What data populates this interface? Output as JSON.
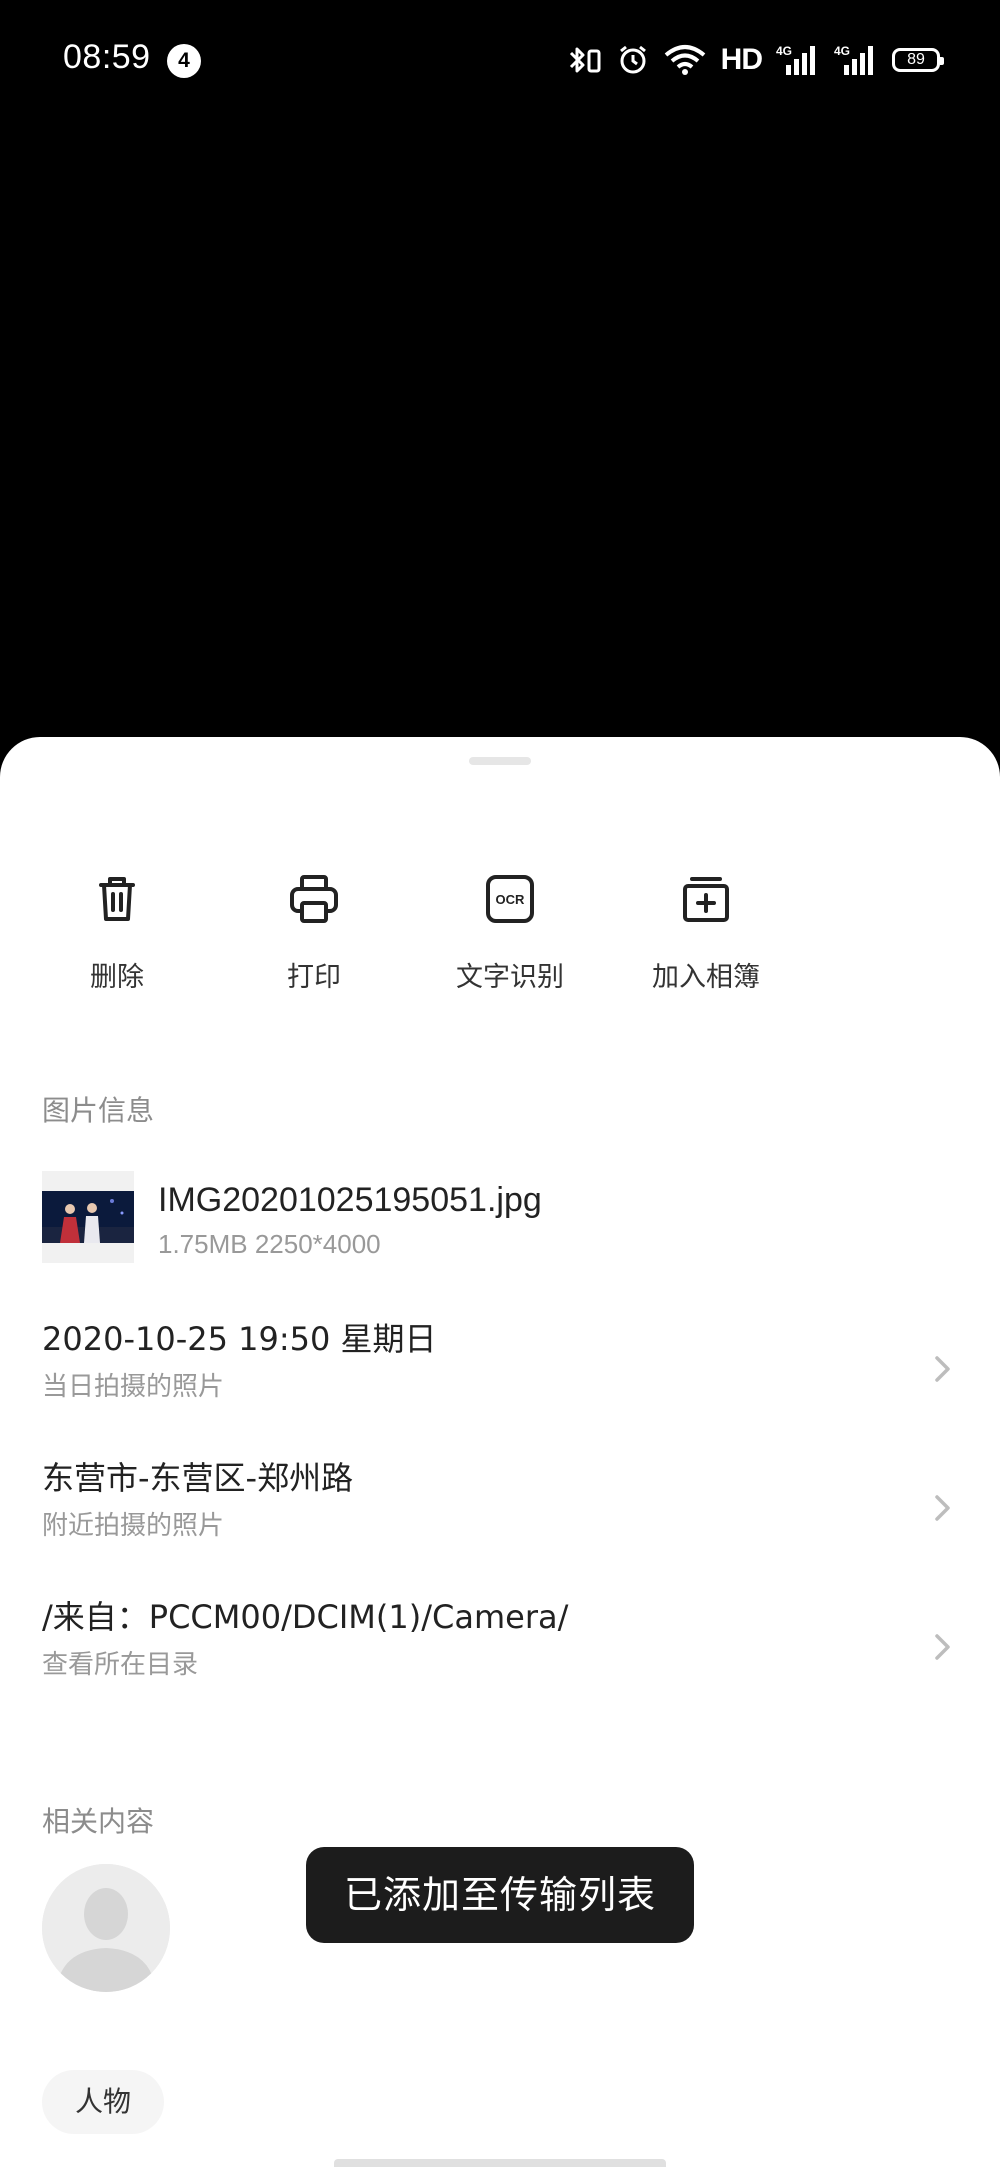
{
  "status_bar": {
    "time": "08:59",
    "notification_count": "4",
    "network_label": "HD",
    "signal_1": "4G",
    "signal_2": "4G",
    "battery": "89"
  },
  "actions": [
    {
      "label": "删除",
      "icon": "trash-icon"
    },
    {
      "label": "打印",
      "icon": "printer-icon"
    },
    {
      "label": "文字识别",
      "icon": "ocr-icon"
    },
    {
      "label": "加入相簿",
      "icon": "add-to-album-icon"
    }
  ],
  "ocr_icon_text": "OCR",
  "photo_info": {
    "section_title": "图片信息",
    "file_name": "IMG20201025195051.jpg",
    "file_meta": "1.75MB 2250*4000"
  },
  "rows": [
    {
      "main": "2020-10-25 19:50 星期日",
      "sub": "当日拍摄的照片"
    },
    {
      "main": "东营市-东营区-郑州路",
      "sub": "附近拍摄的照片"
    },
    {
      "main": "/来自：PCCM00/DCIM(1)/Camera/",
      "sub": "查看所在目录"
    }
  ],
  "related": {
    "section_title": "相关内容",
    "tag": "人物"
  },
  "toast": "已添加至传输列表"
}
